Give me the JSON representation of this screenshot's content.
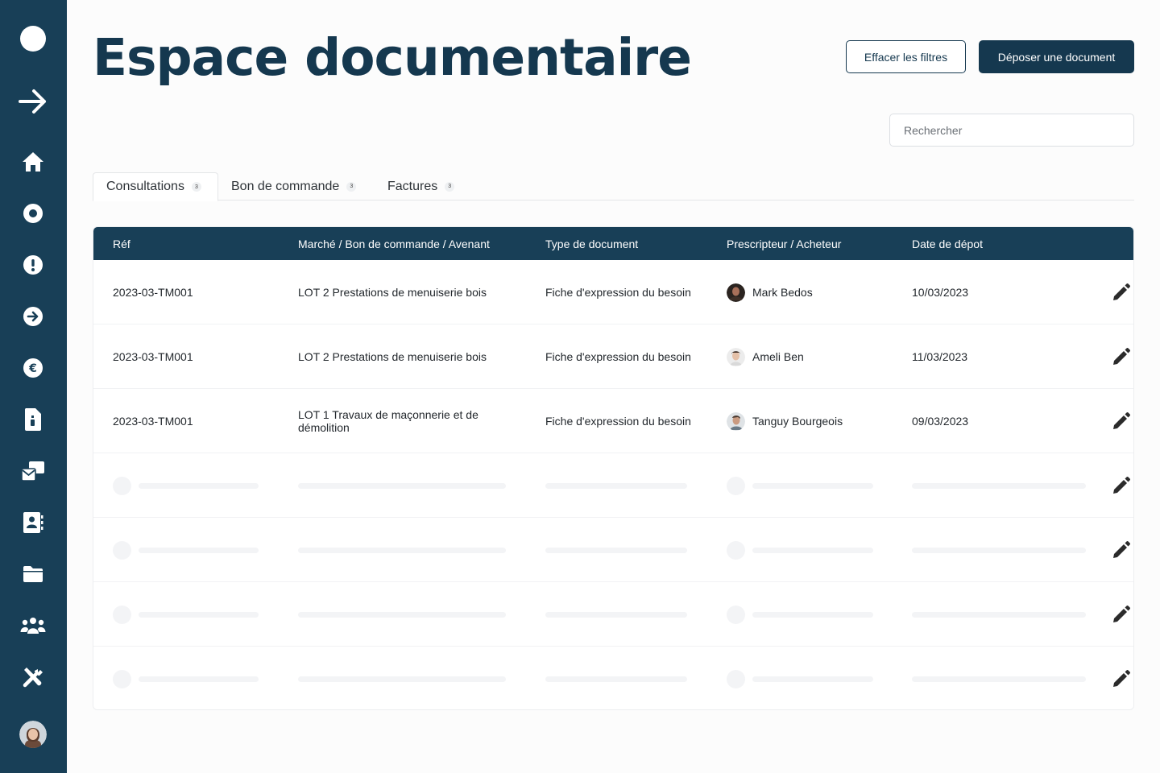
{
  "sidebar": {
    "icons": [
      {
        "name": "logo-circle-icon"
      },
      {
        "name": "expand-arrow-icon"
      },
      {
        "name": "home-icon"
      },
      {
        "name": "record-circle-icon"
      },
      {
        "name": "alert-circle-icon"
      },
      {
        "name": "arrow-circle-right-icon"
      },
      {
        "name": "euro-circle-icon"
      },
      {
        "name": "document-icon"
      },
      {
        "name": "mail-bulk-icon"
      },
      {
        "name": "address-book-icon"
      },
      {
        "name": "folder-icon"
      },
      {
        "name": "users-group-icon"
      },
      {
        "name": "tools-icon"
      }
    ],
    "accent": "#183f57"
  },
  "header": {
    "title": "Espace documentaire",
    "clear_filters_label": "Effacer les filtres",
    "upload_label": "Déposer une document"
  },
  "search": {
    "placeholder": "Rechercher"
  },
  "tabs": [
    {
      "label": "Consultations",
      "count": "3",
      "active": true
    },
    {
      "label": "Bon de commande",
      "count": "3",
      "active": false
    },
    {
      "label": "Factures",
      "count": "3",
      "active": false
    }
  ],
  "table": {
    "headers": {
      "ref": "Réf",
      "marche": "Marché / Bon de commande / Avenant",
      "type": "Type de document",
      "prescripteur": "Prescripteur / Acheteur",
      "date": "Date de dépot"
    },
    "rows": [
      {
        "ref": "2023-03-TM001",
        "marche": "LOT 2 Prestations de menuiserie bois",
        "type": "Fiche d'expression du besoin",
        "person": "Mark Bedos",
        "date": "10/03/2023"
      },
      {
        "ref": "2023-03-TM001",
        "marche": "LOT 2 Prestations de menuiserie bois",
        "type": "Fiche d'expression du besoin",
        "person": "Ameli Ben",
        "date": "11/03/2023"
      },
      {
        "ref": "2023-03-TM001",
        "marche": "LOT 1 Travaux de maçonnerie et de démolition",
        "type": "Fiche d'expression du besoin",
        "person": "Tanguy Bourgeois",
        "date": "09/03/2023"
      }
    ],
    "skeleton_rows": 4
  },
  "colors": {
    "primary": "#15384f",
    "header_bg": "#183f57",
    "skeleton": "#f3f4f6"
  }
}
